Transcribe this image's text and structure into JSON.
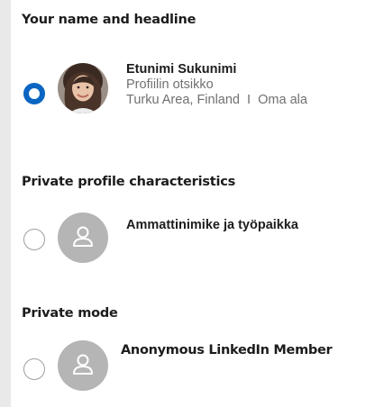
{
  "sections": [
    {
      "title": "Your name and headline",
      "name": "Etunimi Sukunimi",
      "headline": "Profiilin otsikko",
      "location_line": "Turku Area, Finland  I  Oma ala",
      "selected": true,
      "avatar": "profile-photo"
    },
    {
      "title": "Private profile characteristics",
      "name": "Ammattinimike ja työpaikka",
      "selected": false,
      "avatar": "person-placeholder-icon"
    },
    {
      "title": "Private mode",
      "name": "Anonymous LinkedIn Member",
      "selected": false,
      "avatar": "person-placeholder-icon"
    }
  ],
  "colors": {
    "accent": "#0a66c2",
    "placeholder_avatar": "#b5b5b5",
    "secondary_text": "#707070"
  }
}
